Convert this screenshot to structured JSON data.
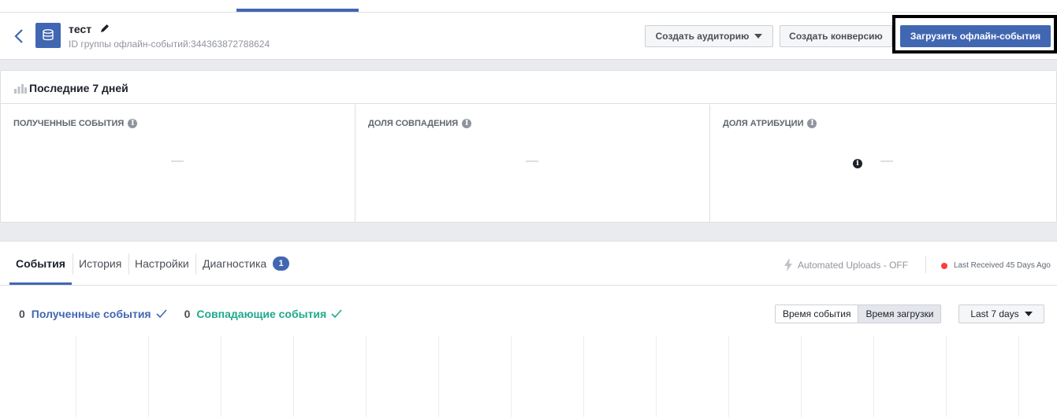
{
  "header": {
    "title": "тест",
    "subtitle": "ID группы офлайн-событий:344363872788624",
    "btn_audience": "Создать аудиторию",
    "btn_conversion": "Создать конверсию",
    "btn_upload": "Загрузить офлайн-события"
  },
  "stats": {
    "period": "Последние 7 дней",
    "columns": [
      {
        "label": "ПОЛУЧЕННЫЕ СОБЫТИЯ",
        "value": "—"
      },
      {
        "label": "ДОЛЯ СОВПАДЕНИЯ",
        "value": "—"
      },
      {
        "label": "ДОЛЯ АТРИБУЦИИ",
        "value": "—"
      }
    ]
  },
  "tabs": {
    "items": [
      "События",
      "История",
      "Настройки",
      "Диагностика"
    ],
    "diagnostics_badge": "1",
    "automated_uploads": "Automated Uploads - OFF",
    "last_received": "Last Received 45 Days Ago"
  },
  "metrics": [
    {
      "count": "0",
      "name": "Полученные события"
    },
    {
      "count": "0",
      "name": "Совпадающие события"
    }
  ],
  "time_toggle": {
    "event_time": "Время события",
    "upload_time": "Время загрузки"
  },
  "range": {
    "label": "Last 7 days"
  },
  "colors": {
    "brand": "#4267b2",
    "green": "#20a98c",
    "red_dot": "#fa3e3e"
  }
}
